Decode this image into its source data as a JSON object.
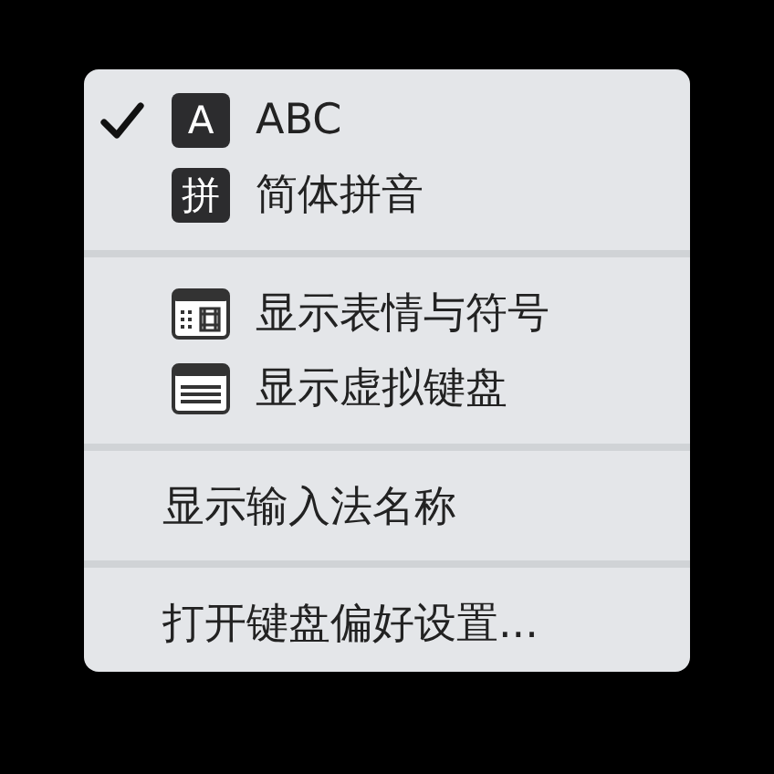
{
  "menu": {
    "sections": [
      {
        "items": [
          {
            "kind": "source",
            "badge": "A",
            "label": "ABC",
            "selected": true
          },
          {
            "kind": "source",
            "badge": "拼",
            "label": "简体拼音",
            "selected": false
          }
        ]
      },
      {
        "items": [
          {
            "kind": "emoji",
            "label": "显示表情与符号"
          },
          {
            "kind": "keyboard",
            "label": "显示虚拟键盘"
          }
        ]
      },
      {
        "items": [
          {
            "kind": "plain",
            "label": "显示输入法名称"
          }
        ]
      },
      {
        "items": [
          {
            "kind": "plain",
            "label": "打开键盘偏好设置..."
          }
        ]
      }
    ]
  }
}
